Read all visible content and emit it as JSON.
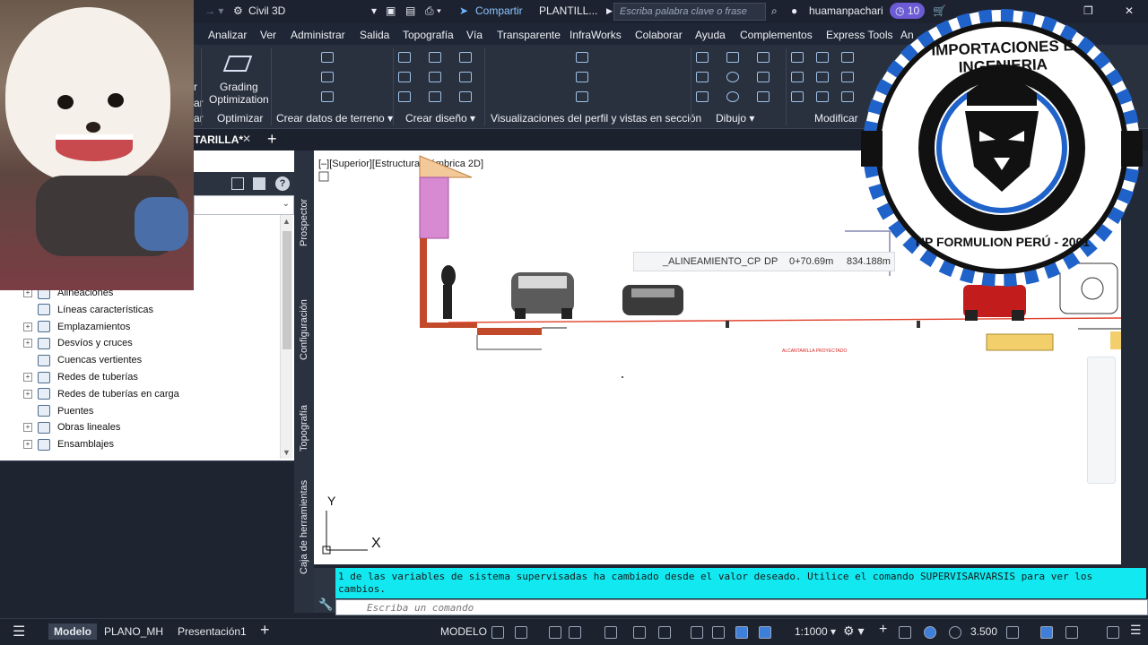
{
  "titlebar": {
    "workspace": "Civil 3D",
    "share": "Compartir",
    "doc_title": "PLANTILL...",
    "search_placeholder": "Escriba palabra clave o frase",
    "user": "huamanpachari",
    "notif_count": "10"
  },
  "menubar": [
    "Analizar",
    "Ver",
    "Administrar",
    "Salida",
    "Topografía",
    "Vía",
    "Transparente",
    "InfraWorks",
    "Colaborar",
    "Ayuda",
    "Complementos",
    "Express Tools",
    "An"
  ],
  "ribbon": {
    "grading_label": "Grading\nOptimization",
    "panels": [
      "Optimizar",
      "Crear datos de terreno ▾",
      "Crear diseño ▾",
      "Visualizaciones del perfil y vistas en sección",
      "Dibujo ▾",
      "Modificar"
    ],
    "partial_left": "r",
    "partial_left2": "ar"
  },
  "tabs": {
    "doc_tab": "TARILLA*",
    "add": "+"
  },
  "palette": {
    "vtabs": [
      "Prospector",
      "Configuración",
      "Topografía",
      "Caja de herramientas"
    ],
    "tree": [
      {
        "label": "Alineaciones",
        "exp": true
      },
      {
        "label": "Líneas características",
        "exp": false
      },
      {
        "label": "Emplazamientos",
        "exp": true
      },
      {
        "label": "Desvíos y cruces",
        "exp": true
      },
      {
        "label": "Cuencas vertientes",
        "exp": false
      },
      {
        "label": "Redes de tuberías",
        "exp": true
      },
      {
        "label": "Redes de tuberías en carga",
        "exp": true
      },
      {
        "label": "Puentes",
        "exp": false
      },
      {
        "label": "Obras lineales",
        "exp": true
      },
      {
        "label": "Ensamblajes",
        "exp": true
      }
    ]
  },
  "viewport": {
    "label": "[–][Superior][Estructura alámbrica 2D]",
    "tooltip_name": "_ALINEAMIENTO_CP",
    "tooltip_dp": "DP",
    "tooltip_station": "0+70.69m",
    "tooltip_elev": "834.188m",
    "red_text": "ALCANTARILLA PROYECTADO",
    "axis_y": "Y",
    "axis_x": "X"
  },
  "command": {
    "message": "1 de las variables de sistema supervisadas ha cambiado desde el valor deseado. Utilice el comando SUPERVISARVARSIS para ver los cambios.",
    "placeholder": "Escriba un comando"
  },
  "statusbar": {
    "tabs": [
      "Modelo",
      "PLANO_MH",
      "Presentación1"
    ],
    "add": "+",
    "mode": "MODELO",
    "scale": "1:1000 ▾",
    "value": "3.500"
  },
  "logo": {
    "top_text": "IMPORTACIONES E INGENIERIA",
    "bottom_text": "HP FORMULION PERÚ - 2001"
  },
  "colors": {
    "cmd_msg_bg": "#11e8f0",
    "logo_blue": "#1f62c9",
    "ground_line": "#e0402a"
  }
}
